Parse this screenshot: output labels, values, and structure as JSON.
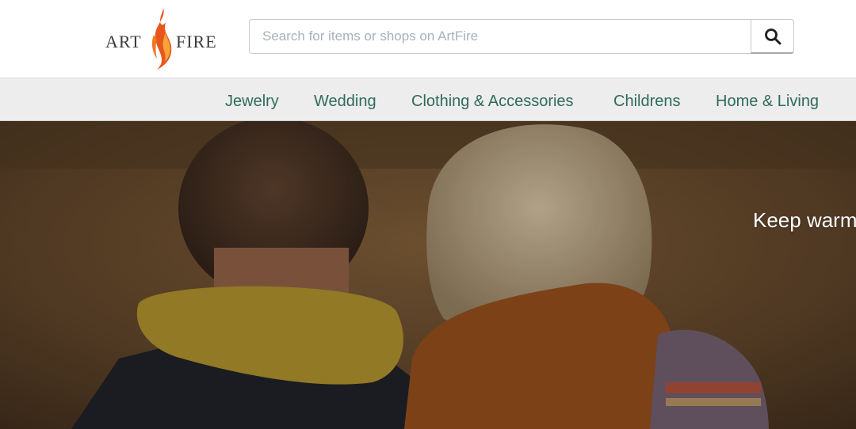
{
  "header": {
    "logo": {
      "left_text": "ART",
      "right_text": "FIRE"
    },
    "search": {
      "placeholder": "Search for items or shops on ArtFire",
      "value": "",
      "button_icon": "search-icon"
    }
  },
  "nav": {
    "items": [
      {
        "label": "Jewelry"
      },
      {
        "label": "Wedding"
      },
      {
        "label": "Clothing & Accessories"
      },
      {
        "label": "Childrens"
      },
      {
        "label": "Home & Living"
      }
    ]
  },
  "hero": {
    "caption": "Keep warm"
  },
  "colors": {
    "nav_text": "#2e6b5c",
    "nav_bg": "#ededed",
    "flame_outer": "#e8561c",
    "flame_inner": "#f8a23a"
  }
}
